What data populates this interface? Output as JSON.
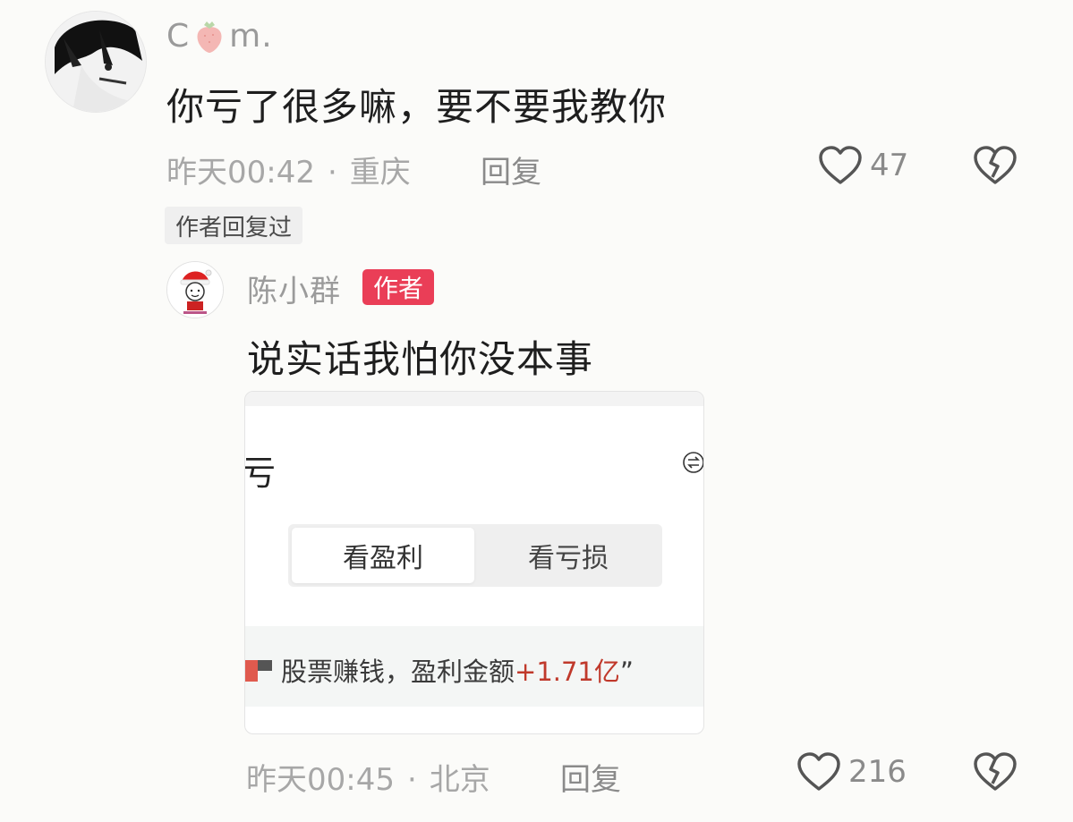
{
  "comment": {
    "username_prefix": "C",
    "username_suffix": "m.",
    "text": "你亏了很多嘛，要不要我教你",
    "time": "昨天00:42",
    "location": "重庆",
    "reply_label": "回复",
    "like_count": "47",
    "author_replied_tag": "作者回复过"
  },
  "reply": {
    "username": "陈小群",
    "author_badge": "作者",
    "text": "说实话我怕你没本事",
    "time": "昨天00:45",
    "location": "北京",
    "reply_label": "回复",
    "like_count": "216",
    "card": {
      "left_glyph": "亏",
      "segment_active": "看盈利",
      "segment_inactive": "看亏损",
      "stock_text": "股票赚钱，盈利金额",
      "stock_amount": "+1.71亿",
      "stock_quote": "”"
    }
  },
  "colors": {
    "author_badge_bg": "#ea3e57",
    "profit_red": "#c0392b"
  },
  "icons": {
    "like": "heart-outline-icon",
    "dislike": "broken-heart-icon",
    "swap": "swap-icon"
  }
}
